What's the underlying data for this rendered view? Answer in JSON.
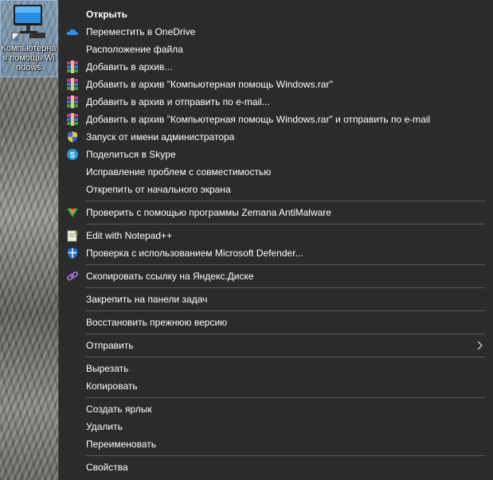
{
  "desktop": {
    "icon_label": "Компьютерная помощь Windows"
  },
  "menu": {
    "items": [
      {
        "label": "Открыть",
        "bold": true,
        "icon": "none"
      },
      {
        "label": "Переместить в OneDrive",
        "icon": "onedrive-icon"
      },
      {
        "label": "Расположение файла",
        "icon": "none"
      },
      {
        "label": "Добавить в архив...",
        "icon": "winrar-icon"
      },
      {
        "label": "Добавить в архив \"Компьютерная помощь Windows.rar\"",
        "icon": "winrar-icon"
      },
      {
        "label": "Добавить в архив и отправить по e-mail...",
        "icon": "winrar-icon"
      },
      {
        "label": "Добавить в архив \"Компьютерная помощь Windows.rar\" и отправить по e-mail",
        "icon": "winrar-icon"
      },
      {
        "label": "Запуск от имени администратора",
        "icon": "uac-shield-icon"
      },
      {
        "label": "Поделиться в Skype",
        "icon": "skype-icon"
      },
      {
        "label": "Исправление проблем с совместимостью",
        "icon": "none"
      },
      {
        "label": "Открепить от начального экрана",
        "icon": "none"
      },
      {
        "label": "Проверить с помощью программы Zemana AntiMalware",
        "icon": "zemana-icon"
      },
      {
        "label": "Edit with Notepad++",
        "icon": "notepadpp-icon"
      },
      {
        "label": "Проверка с использованием Microsoft Defender...",
        "icon": "defender-icon"
      },
      {
        "label": "Скопировать ссылку на Яндекс.Диске",
        "icon": "yandex-disk-link-icon"
      },
      {
        "label": "Закрепить на панели задач",
        "icon": "none"
      },
      {
        "label": "Восстановить прежнюю версию",
        "icon": "none"
      },
      {
        "label": "Отправить",
        "icon": "none",
        "submenu": true
      },
      {
        "label": "Вырезать",
        "icon": "none"
      },
      {
        "label": "Копировать",
        "icon": "none"
      },
      {
        "label": "Создать ярлык",
        "icon": "none"
      },
      {
        "label": "Удалить",
        "icon": "none"
      },
      {
        "label": "Переименовать",
        "icon": "none"
      },
      {
        "label": "Свойства",
        "icon": "none"
      }
    ],
    "submenu_arrow": "›"
  },
  "colors": {
    "menu_bg": "#2b2b2b",
    "separator": "#5a5a5a",
    "text": "#ffffff"
  }
}
